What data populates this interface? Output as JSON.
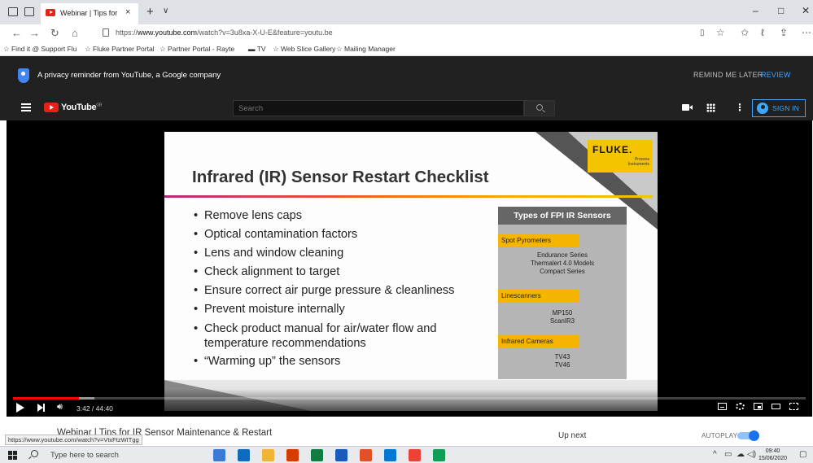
{
  "browser": {
    "tab_title": "Webinar | Tips for IR Ser",
    "tab_close": "×",
    "new_tab": "+",
    "tab_menu": "∨",
    "url_prefix": "https://",
    "url_host": "www.youtube.com",
    "url_path": "/watch?v=3u8xa-X-U-E&feature=youtu.be",
    "favorites": [
      "Find it @ Support Flu",
      "Fluke Partner Portal",
      "Partner Portal - Rayte",
      "TV",
      "Web Slice Gallery",
      "Mailing Manager"
    ]
  },
  "youtube": {
    "privacy_text": "A privacy reminder from YouTube, a Google company",
    "remind_later": "REMIND ME LATER",
    "review": "REVIEW",
    "logo_text": "YouTube",
    "logo_region": "GB",
    "search_placeholder": "Search",
    "sign_in": "SIGN IN"
  },
  "slide": {
    "brand": "FLUKE.",
    "brand_sub_1": "Process",
    "brand_sub_2": "Instruments",
    "title": "Infrared (IR) Sensor Restart Checklist",
    "bullets": [
      "Remove lens caps",
      "Optical contamination factors",
      "Lens and window cleaning",
      "Check alignment to target",
      "Ensure correct air purge pressure & cleanliness",
      "Prevent moisture internally",
      "Check product manual for air/water flow and",
      "temperature recommendations",
      "“Warming up” the sensors"
    ],
    "box_title": "Types of FPI IR Sensors",
    "categories": [
      {
        "name": "Spot Pyrometers",
        "items": [
          "Endurance Series",
          "Thermalert 4.0 Models",
          "Compact Series"
        ]
      },
      {
        "name": "Linescanners",
        "items": [
          "MP150",
          "ScanIR3"
        ]
      },
      {
        "name": "Infrared Cameras",
        "items": [
          "TV43",
          "TV46"
        ]
      }
    ]
  },
  "player": {
    "time": "3:42 / 44:40",
    "progress": 0.083
  },
  "below": {
    "video_title": "Webinar | Tips for IR Sensor Maintenance & Restart",
    "status_url": "https://www.youtube.com/watch?v=VtxFtzWITgg",
    "up_next": "Up next",
    "autoplay": "AUTOPLAY"
  },
  "taskbar": {
    "search_placeholder": "Type here to search",
    "time": "09:40",
    "date": "15/06/2020",
    "app_colors": [
      "#3a7bd5",
      "#0f6cbd",
      "#f1b434",
      "#d83b01",
      "#107c41",
      "#185abd",
      "#e34f26",
      "#0078d4",
      "#ea4335",
      "#0f9d58"
    ]
  }
}
